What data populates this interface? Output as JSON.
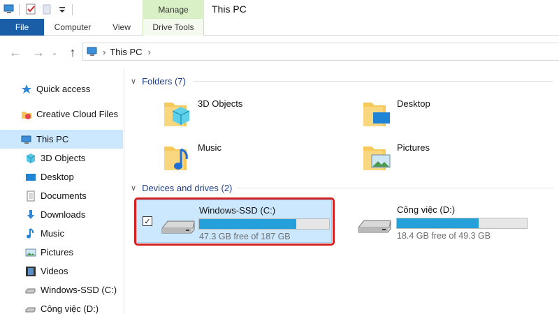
{
  "window": {
    "title": "This PC"
  },
  "ribbon": {
    "contextual_group": "Manage",
    "tabs": [
      {
        "label": "File"
      },
      {
        "label": "Computer"
      },
      {
        "label": "View"
      },
      {
        "label": "Drive Tools"
      }
    ]
  },
  "address": {
    "path": "This PC"
  },
  "sidebar": {
    "items": [
      {
        "label": "Quick access",
        "icon": "star-icon"
      },
      {
        "label": "Creative Cloud Files",
        "icon": "creative-cloud-folder-icon"
      },
      {
        "label": "This PC",
        "icon": "computer-icon",
        "selected": true
      },
      {
        "label": "3D Objects",
        "icon": "cube-icon"
      },
      {
        "label": "Desktop",
        "icon": "desktop-icon"
      },
      {
        "label": "Documents",
        "icon": "document-icon"
      },
      {
        "label": "Downloads",
        "icon": "download-arrow-icon"
      },
      {
        "label": "Music",
        "icon": "music-note-icon"
      },
      {
        "label": "Pictures",
        "icon": "picture-icon"
      },
      {
        "label": "Videos",
        "icon": "film-icon"
      },
      {
        "label": "Windows-SSD (C:)",
        "icon": "drive-icon"
      },
      {
        "label": "Công việc (D:)",
        "icon": "drive-icon"
      }
    ]
  },
  "folders": {
    "header": "Folders (7)",
    "items": [
      {
        "label": "3D Objects",
        "icon": "folder-3d-objects-icon"
      },
      {
        "label": "Desktop",
        "icon": "folder-desktop-icon"
      },
      {
        "label": "Music",
        "icon": "folder-music-icon"
      },
      {
        "label": "Pictures",
        "icon": "folder-pictures-icon"
      }
    ]
  },
  "drives": {
    "header": "Devices and drives (2)",
    "items": [
      {
        "name": "Windows-SSD (C:)",
        "free_text": "47.3 GB free of 187 GB",
        "used_fraction": 0.747,
        "selected": true,
        "checked": "✓"
      },
      {
        "name": "Công việc (D:)",
        "free_text": "18.4 GB free of 49.3 GB",
        "used_fraction": 0.627,
        "selected": false
      }
    ]
  },
  "colors": {
    "accent": "#1b5ea8",
    "selection": "#cce8ff",
    "bar_fill": "#26a0da",
    "highlight_outline": "#d32020",
    "contextual_tab": "#d9f0c6"
  }
}
